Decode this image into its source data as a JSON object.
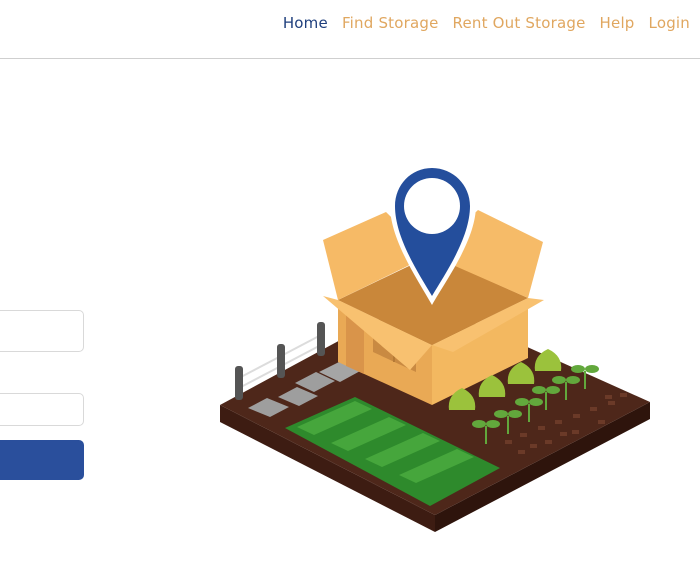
{
  "nav": {
    "items": [
      {
        "label": "Home",
        "active": true
      },
      {
        "label": "Find Storage",
        "active": false
      },
      {
        "label": "Rent Out Storage",
        "active": false
      },
      {
        "label": "Help",
        "active": false
      },
      {
        "label": "Login",
        "active": false
      }
    ]
  },
  "form": {
    "field1_value": "",
    "field2_value": "",
    "submit_label": ""
  },
  "colors": {
    "nav_active": "#1f3f7d",
    "nav_inactive": "#e0a760",
    "primary_button": "#2a4f9c",
    "pin": "#244e9c",
    "box": "#f5b862",
    "soil": "#4a2418",
    "grass": "#3a9a34"
  },
  "illustration": {
    "icon": "storage-box-location-illustration"
  }
}
